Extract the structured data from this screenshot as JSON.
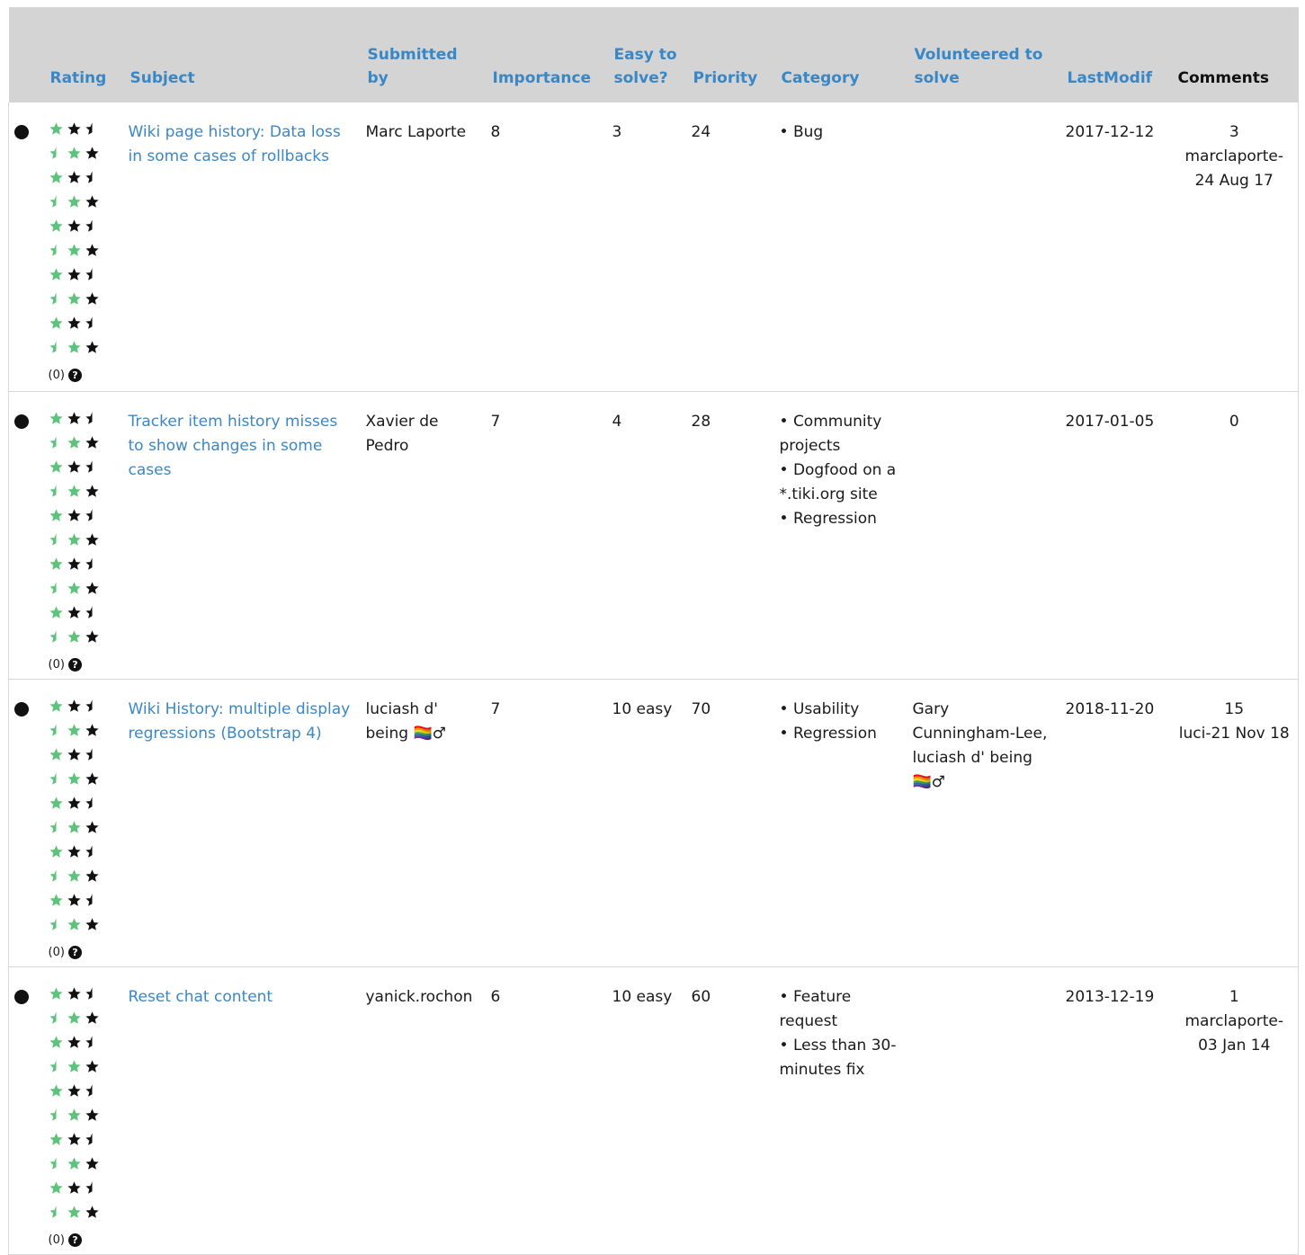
{
  "columns": {
    "rating": "Rating",
    "subject": "Subject",
    "submitted": "Submitted by",
    "importance": "Importance",
    "easy": "Easy to solve?",
    "priority": "Priority",
    "category": "Category",
    "volunteered": "Volunteered to solve",
    "lastmodif": "LastModif",
    "comments": "Comments"
  },
  "rating_meta": "(0)",
  "help_icon": "question-circle-icon",
  "colors": {
    "link": "#3a87c6",
    "star_green": "#5cc47a",
    "star_black": "#111111",
    "header_bg": "#d4d4d4"
  },
  "rows": [
    {
      "subject": "Wiki page history: Data loss in some cases of rollbacks",
      "submitted": "Marc Laporte",
      "importance": "8",
      "easy": "3",
      "priority": "24",
      "categories": [
        "Bug"
      ],
      "volunteered": "",
      "lastmodif": "2017-12-12",
      "comments_count": "3",
      "comments_last": "marclaporte-24 Aug 17"
    },
    {
      "subject": "Tracker item history misses to show changes in some cases",
      "submitted": "Xavier de Pedro",
      "importance": "7",
      "easy": "4",
      "priority": "28",
      "categories": [
        "Community projects",
        "Dogfood on a *.tiki.org site",
        "Regression"
      ],
      "volunteered": "",
      "lastmodif": "2017-01-05",
      "comments_count": "0",
      "comments_last": ""
    },
    {
      "subject": "Wiki History: multiple display regressions (Bootstrap 4)",
      "submitted": "luciash d' being 🏳️‍🌈♂",
      "importance": "7",
      "easy": "10 easy",
      "priority": "70",
      "categories": [
        "Usability",
        "Regression"
      ],
      "volunteered": "Gary Cunningham-Lee, luciash d' being 🏳️‍🌈♂",
      "lastmodif": "2018-11-20",
      "comments_count": "15",
      "comments_last": "luci-21 Nov 18"
    },
    {
      "subject": "Reset chat content",
      "submitted": "yanick.rochon",
      "importance": "6",
      "easy": "10 easy",
      "priority": "60",
      "categories": [
        "Feature request",
        "Less than 30-minutes fix"
      ],
      "volunteered": "",
      "lastmodif": "2013-12-19",
      "comments_count": "1",
      "comments_last": "marclaporte-03 Jan 14"
    }
  ]
}
